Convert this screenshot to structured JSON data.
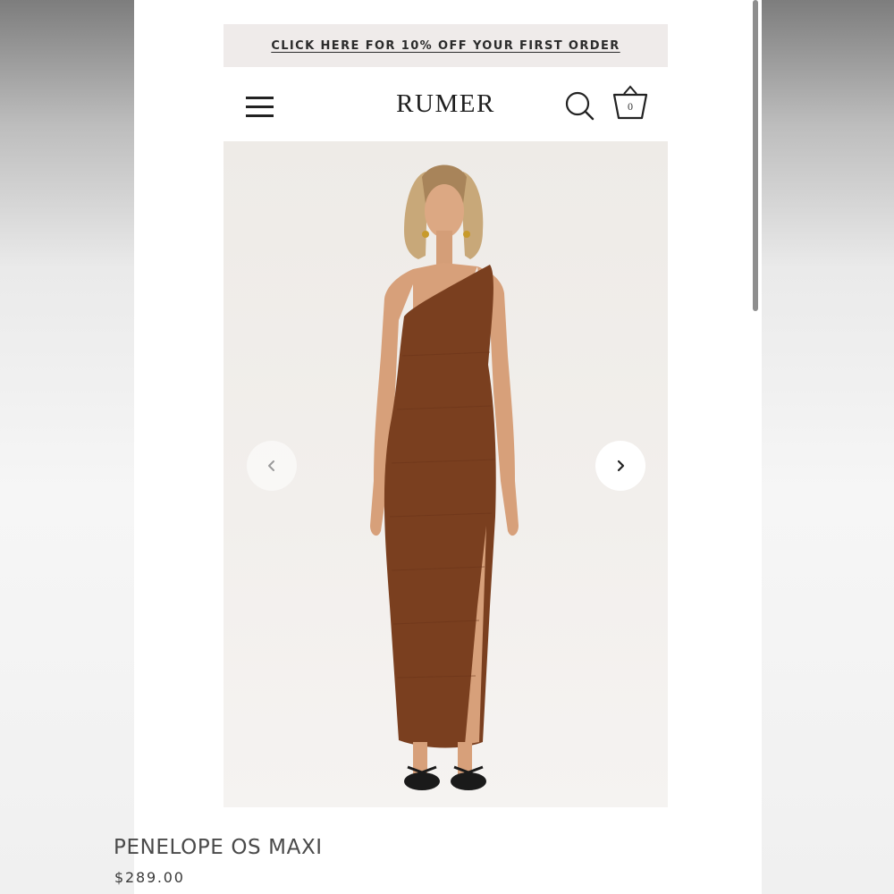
{
  "promo": {
    "text": "CLICK HERE FOR 10% OFF YOUR FIRST ORDER"
  },
  "header": {
    "logo": "RUMER",
    "menu_icon": "hamburger-menu-icon",
    "search_icon": "search-icon",
    "cart_icon": "basket-icon",
    "cart_count": "0"
  },
  "gallery": {
    "prev_icon": "chevron-left-icon",
    "next_icon": "chevron-right-icon"
  },
  "product": {
    "title": "PENELOPE OS MAXI",
    "price": "$289.00"
  },
  "colors": {
    "promo_bg": "#efebea",
    "dress": "#7a3f1f",
    "text_dark": "#1f1f1f"
  }
}
